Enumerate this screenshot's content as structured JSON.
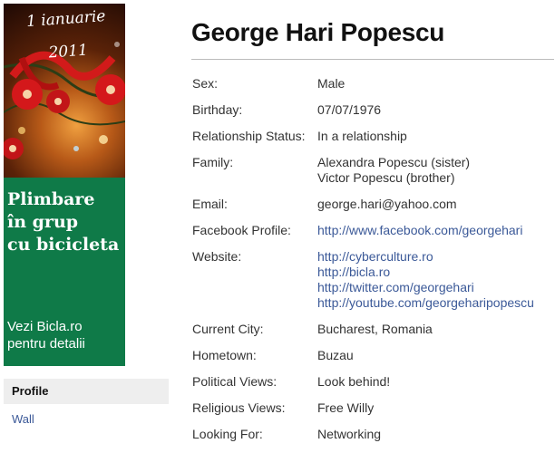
{
  "ad": {
    "date_line1": "1 ianuarie",
    "date_line2": "2011",
    "headline": [
      "Plimbare",
      "în grup",
      "cu bicicleta"
    ],
    "subtext": [
      "Vezi Bicla.ro",
      "pentru detalii"
    ],
    "green_color": "#0f7a48"
  },
  "nav": {
    "profile_label": "Profile",
    "wall_label": "Wall"
  },
  "profile": {
    "name": "George Hari Popescu",
    "sex": {
      "label": "Sex:",
      "value": "Male"
    },
    "birthday": {
      "label": "Birthday:",
      "value": "07/07/1976"
    },
    "relationship": {
      "label": "Relationship Status:",
      "value": "In a relationship"
    },
    "family": {
      "label": "Family:",
      "values": [
        "Alexandra Popescu (sister)",
        "Victor Popescu (brother)"
      ]
    },
    "email": {
      "label": "Email:",
      "value": "george.hari@yahoo.com"
    },
    "facebook": {
      "label": "Facebook Profile:",
      "value": "http://www.facebook.com/georgehari"
    },
    "website": {
      "label": "Website:",
      "values": [
        "http://cyberculture.ro",
        "http://bicla.ro",
        "http://twitter.com/georgehari",
        "http://youtube.com/georgeharipopescu"
      ]
    },
    "current_city": {
      "label": "Current City:",
      "value": "Bucharest, Romania"
    },
    "hometown": {
      "label": "Hometown:",
      "value": "Buzau"
    },
    "political": {
      "label": "Political Views:",
      "value": "Look behind!"
    },
    "religious": {
      "label": "Religious Views:",
      "value": "Free Willy"
    },
    "looking_for": {
      "label": "Looking For:",
      "value": "Networking"
    }
  },
  "colors": {
    "link": "#3b5998",
    "nav_background": "#eeeeee"
  }
}
